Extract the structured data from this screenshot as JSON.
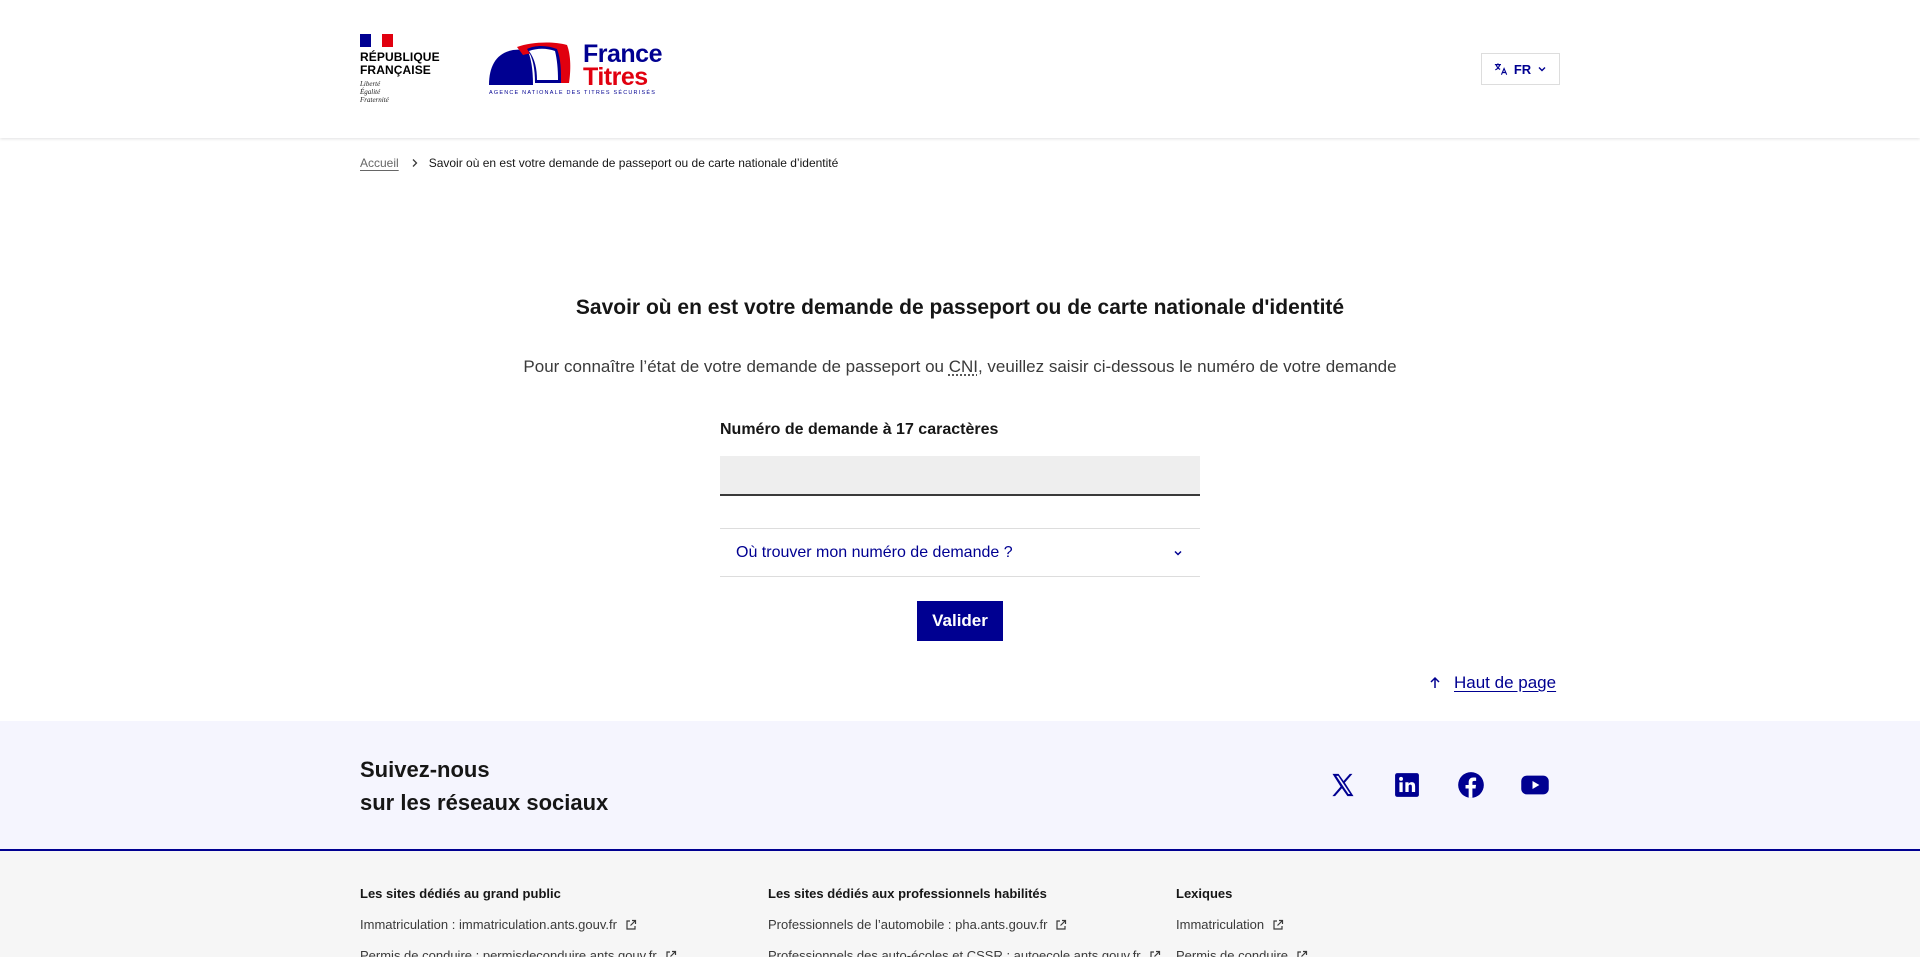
{
  "header": {
    "republic_line1": "RÉPUBLIQUE",
    "republic_line2": "FRANÇAISE",
    "motto_line1": "Liberté",
    "motto_line2": "Égalité",
    "motto_line3": "Fraternité",
    "logo_word1": "France",
    "logo_word2": "Titres",
    "logo_tagline": "Agence nationale des titres sécurisés",
    "lang_label": "FR"
  },
  "breadcrumb": {
    "home": "Accueil",
    "current": "Savoir où en est votre demande de passeport ou de carte nationale d’identité"
  },
  "main": {
    "title": "Savoir où en est votre demande de passeport ou de carte nationale d'identité",
    "intro_before": "Pour connaître l’état de votre demande de passeport ou ",
    "intro_abbr": "CNI",
    "intro_after": ", veuillez saisir ci-dessous le numéro de votre demande",
    "field_label": "Numéro de demande à 17 caractères",
    "field_value": "",
    "accordion_label": "Où trouver mon numéro de demande ?",
    "submit_label": "Valider",
    "back_to_top": "Haut de page"
  },
  "social": {
    "title_line1": "Suivez-nous",
    "title_line2": "sur les réseaux sociaux",
    "networks": [
      "x-icon",
      "linkedin-icon",
      "facebook-icon",
      "youtube-icon"
    ]
  },
  "footer": {
    "col1": {
      "title": "Les sites dédiés au grand public",
      "links": [
        "Immatriculation : immatriculation.ants.gouv.fr",
        "Permis de conduire : permisdeconduire.ants.gouv.fr"
      ]
    },
    "col2": {
      "title": "Les sites dédiés aux professionnels habilités",
      "links": [
        "Professionnels de l’automobile : pha.ants.gouv.fr",
        "Professionnels des auto-écoles et CSSR : autoecole.ants.gouv.fr"
      ]
    },
    "col3": {
      "title": "Lexiques",
      "links": [
        "Immatriculation",
        "Permis de conduire"
      ]
    }
  },
  "colors": {
    "primary_blue": "#000091",
    "marianne_red": "#e1000f",
    "social_band_bg": "#f5f5fe",
    "footer_bg": "#f6f6f6"
  }
}
